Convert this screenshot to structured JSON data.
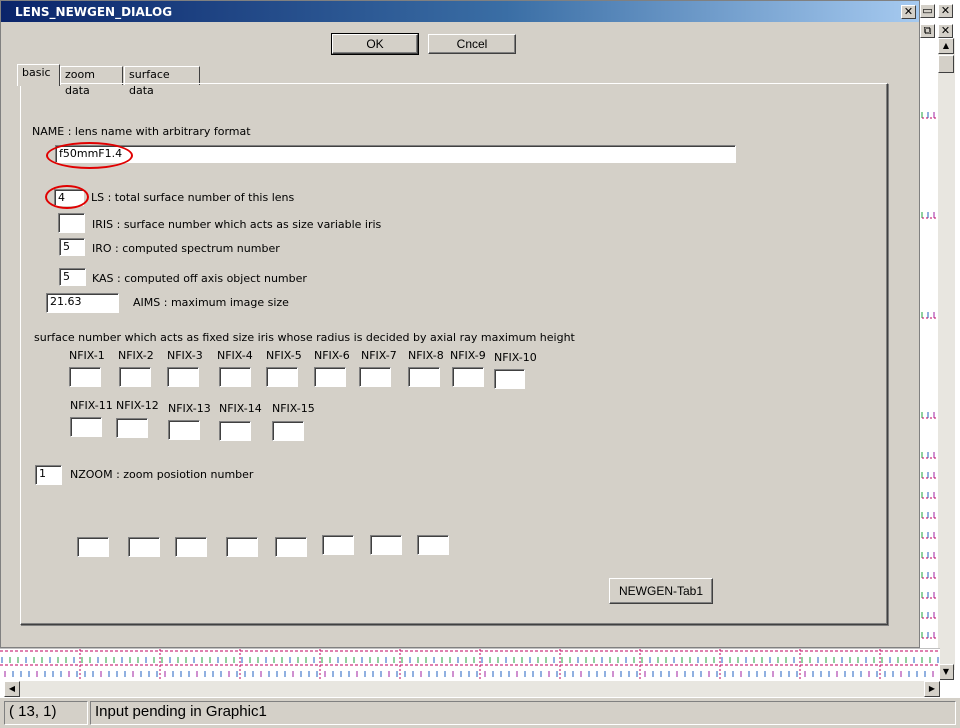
{
  "window": {
    "title": "LENS_NEWGEN_DIALOG",
    "close_glyph": "✕",
    "maximize_glyph": "□",
    "minimize_glyph": "▭",
    "restore_glyph": "⧉"
  },
  "buttons": {
    "ok_label": "OK",
    "cancel_label": "Cncel",
    "newgen_label": "NEWGEN-Tab1"
  },
  "tabs": [
    {
      "label": "basic",
      "active": true
    },
    {
      "label": "zoom data",
      "active": false
    },
    {
      "label": "surface data",
      "active": false
    }
  ],
  "fields": {
    "name_label": "NAME : lens name with arbitrary format",
    "name_value": "f50mmF1.4",
    "ls_value": "4",
    "ls_label": "LS : total surface number of this lens",
    "iris_value": "",
    "iris_label": "IRIS : surface number which acts as size variable iris",
    "iro_value": "5",
    "iro_label": "IRO : computed spectrum number",
    "kas_value": "5",
    "kas_label": "KAS : computed off axis object number",
    "aims_value": "21.63",
    "aims_label": "AIMS : maximum image size",
    "nfix_heading": "surface number which acts as fixed size iris whose radius is decided by axial ray maximum height",
    "nfix_labels": [
      "NFIX-1",
      "NFIX-2",
      "NFIX-3",
      "NFIX-4",
      "NFIX-5",
      "NFIX-6",
      "NFIX-7",
      "NFIX-8",
      "NFIX-9",
      "NFIX-10",
      "NFIX-11",
      "NFIX-12",
      "NFIX-13",
      "NFIX-14",
      "NFIX-15"
    ],
    "nfix_values": [
      "",
      "",
      "",
      "",
      "",
      "",
      "",
      "",
      "",
      "",
      "",
      "",
      "",
      "",
      ""
    ],
    "nzoom_value": "1",
    "nzoom_label": "NZOOM : zoom posiotion number",
    "zoom_values": [
      "",
      "",
      "",
      "",
      "",
      "",
      "",
      ""
    ]
  },
  "statusbar": {
    "coords": "(  13,   1)",
    "message": "Input pending in Graphic1"
  },
  "colors": {
    "title_start": "#0a246a",
    "title_end": "#a6caf0",
    "dialog_bg": "#d4d0c8",
    "highlight_circle": "#e00000"
  }
}
